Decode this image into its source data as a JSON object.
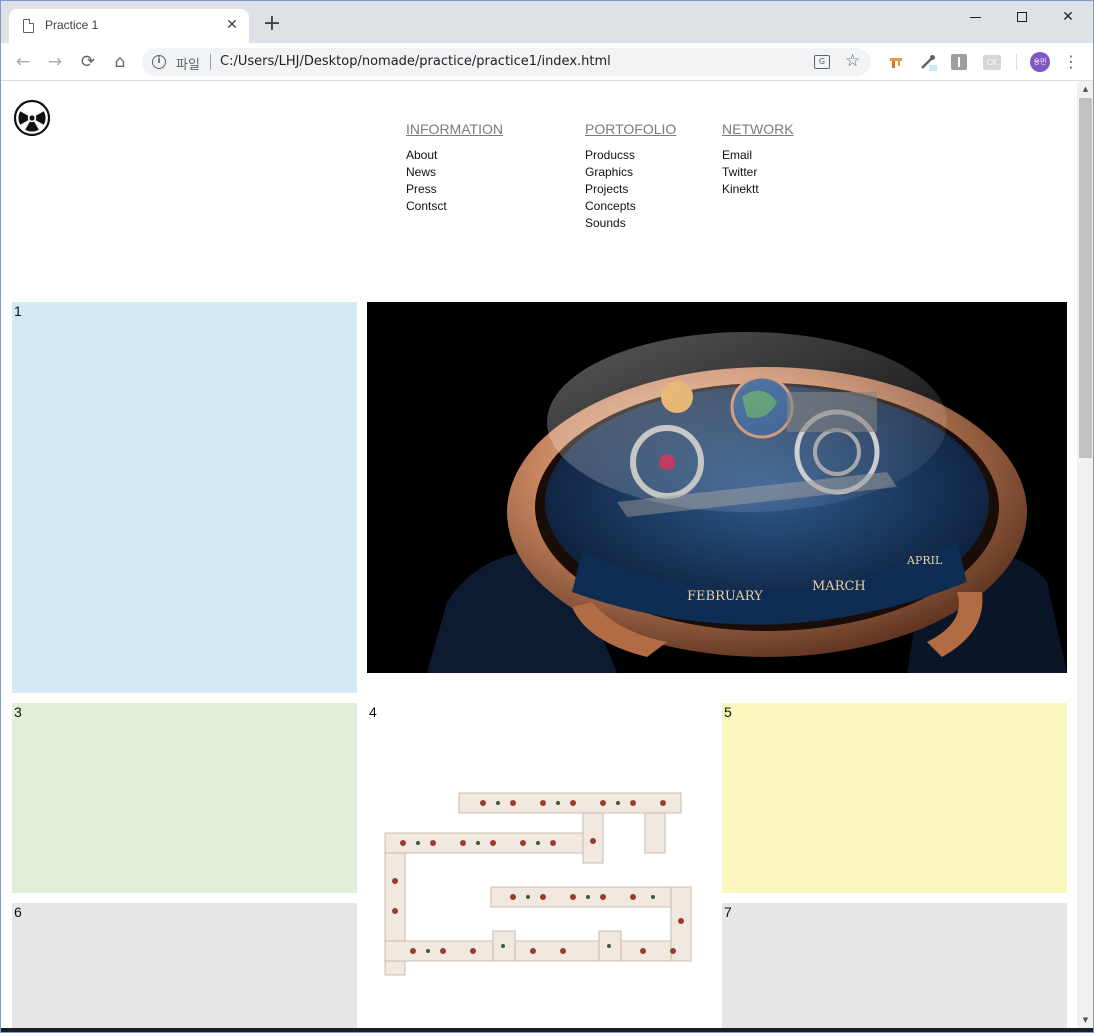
{
  "browser": {
    "tab_title": "Practice 1",
    "tab_close": "✕",
    "new_tab": "+",
    "url_scheme_label": "파일",
    "url": "C:/Users/LHJ/Desktop/nomade/practice/practice1/index.html",
    "avatar_text": "용민",
    "win_close": "✕"
  },
  "nav": {
    "columns": [
      {
        "heading": "INFORMATION",
        "links": [
          "About",
          "News",
          "Press",
          "Contsct"
        ]
      },
      {
        "heading": "PORTOFOLIO",
        "links": [
          "Producss",
          "Graphics",
          "Projects",
          "Concepts",
          "Sounds"
        ]
      },
      {
        "heading": "NETWORK",
        "links": [
          "Email",
          "Twitter",
          "Kinektt"
        ]
      }
    ]
  },
  "grid": {
    "box1": "1",
    "box3": "3",
    "box4": "4",
    "box5": "5",
    "box6": "6",
    "box7": "7"
  },
  "watch_image": {
    "dial_text": [
      "FEBRUARY",
      "MARCH",
      "APRIL"
    ]
  },
  "colors": {
    "box1": "#d3e9f3",
    "box3": "#e1eed8",
    "box5": "#fbf6bd",
    "box6_7": "#e6e6e6",
    "watch_bg": "#000000",
    "nav_heading": "#7b7b7b"
  },
  "icons": [
    "page-icon",
    "back-arrow-icon",
    "forward-arrow-icon",
    "reload-icon",
    "home-icon",
    "info-icon",
    "translate-icon",
    "star-icon",
    "kebab-menu-icon",
    "radiation-icon"
  ]
}
